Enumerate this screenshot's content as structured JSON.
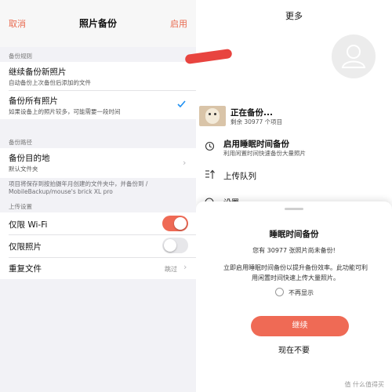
{
  "left": {
    "nav": {
      "cancel": "取消",
      "title": "照片备份",
      "enable": "启用"
    },
    "backup_rules": {
      "header": "备份规则",
      "options": [
        {
          "title": "继续备份新照片",
          "subtitle": "自动备份上次备份后添加的文件"
        },
        {
          "title": "备份所有照片",
          "subtitle": "如果设备上的照片较多，可能需要一段时间"
        }
      ]
    },
    "backup_path": {
      "header": "备份路径",
      "title": "备份目的地",
      "subtitle": "默认文件夹",
      "note_line1": "项目将保存到按拍摄年月创建的文件夹中，并备份到 /",
      "note_line2": "MobileBackup/mouse's brick XL pro"
    },
    "upload_settings": {
      "header": "上传设置",
      "wifi_label": "仅限 Wi-Fi",
      "photos_only_label": "仅限照片",
      "duplicate_label": "重复文件",
      "duplicate_value": "跳过"
    }
  },
  "right": {
    "title": "更多",
    "backup_status": {
      "title": "正在备份...",
      "subtitle": "剩余 30977 个项目"
    },
    "sleep_backup": {
      "title": "启用睡眠时间备份",
      "subtitle": "利用闲置时间快速备份大量照片"
    },
    "upload_queue": "上传队列",
    "settings_cut": "设置",
    "sheet": {
      "title": "睡眠时间备份",
      "count_text": "您有 30977 张照片尚未备份!",
      "desc_line1": "立即启用睡眠时间备份以提升备份效率。此功能可利",
      "desc_line2": "用闲置时间快速上传大量照片。",
      "dont_show": "不再显示",
      "continue": "继续",
      "later": "现在不要"
    },
    "watermark": "值 什么值得买"
  },
  "colors": {
    "accent": "#ef6a55",
    "check_blue": "#1d8ff2",
    "redaction": "#e8443f"
  }
}
